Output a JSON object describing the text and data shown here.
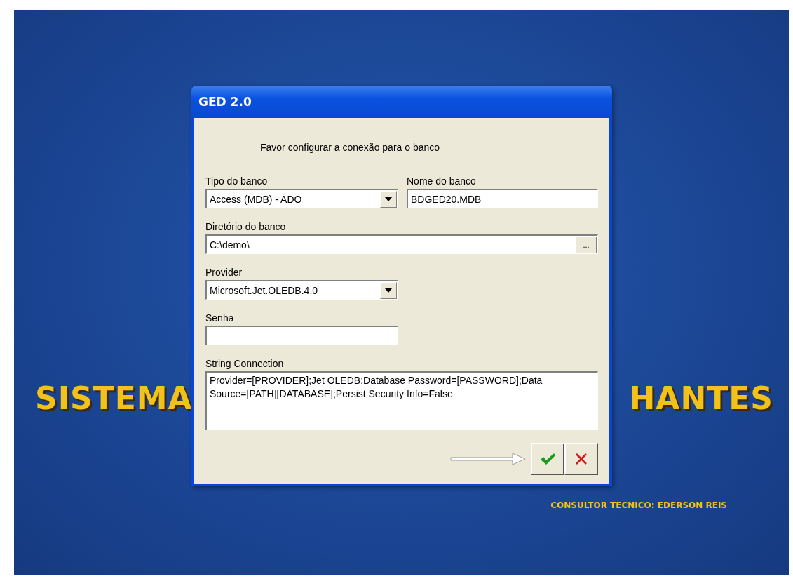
{
  "background": {
    "title_left": "SISTEMA",
    "title_right": "HANTES",
    "credit": "CONSULTOR TECNICO: EDERSON REIS"
  },
  "window": {
    "title": "GED 2.0"
  },
  "prompt": "Favor configurar a conexão para o banco",
  "fields": [
    {
      "kind": "select",
      "label": "Tipo do banco",
      "value": "Access (MDB) - ADO"
    },
    {
      "kind": "text",
      "label": "Nome do banco",
      "value": "BDGED20.MDB"
    },
    {
      "kind": "browse",
      "label": "Diretório do banco",
      "value": "C:\\demo\\",
      "button": "..."
    },
    {
      "kind": "select",
      "label": "Provider",
      "value": "Microsoft.Jet.OLEDB.4.0"
    },
    {
      "kind": "password",
      "label": "Senha"
    },
    {
      "kind": "memo",
      "label": "String Connection",
      "value": "Provider=[PROVIDER];Jet OLEDB:Database Password=[PASSWORD];Data Source=[PATH][DATABASE];Persist Security Info=False"
    }
  ],
  "buttons": [
    {
      "kind": "ok"
    },
    {
      "kind": "cancel"
    }
  ]
}
